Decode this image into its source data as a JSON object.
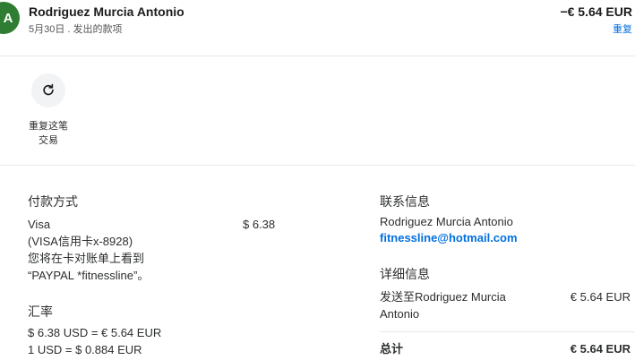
{
  "header": {
    "avatar_initial": "A",
    "name": "Rodriguez Murcia Antonio",
    "subtitle": "5月30日 . 发出的款项",
    "amount": "−€ 5.64 EUR",
    "link": "重复"
  },
  "actions": {
    "repeat_label_line1": "重复这笔",
    "repeat_label_line2": "交易"
  },
  "payment_method": {
    "title": "付款方式",
    "lines": [
      "Visa",
      "(VISA信用卡x-8928)",
      "您将在卡对账单上看到",
      "“PAYPAL *fitnessline”。"
    ],
    "amount": "$ 6.38"
  },
  "exchange": {
    "title": "汇率",
    "line1": "$ 6.38 USD = € 5.64 EUR",
    "line2": "1 USD = $ 0.884 EUR"
  },
  "contact": {
    "title": "联系信息",
    "name": "Rodriguez Murcia Antonio",
    "email": "fitnessline@hotmail.com"
  },
  "details": {
    "title": "详细信息",
    "sent_to_line1": "发送至Rodriguez Murcia",
    "sent_to_line2": "Antonio",
    "sent_amount": "€ 5.64 EUR",
    "total_label": "总计",
    "total_amount": "€ 5.64 EUR"
  },
  "colors": {
    "avatar": "#2e7d32",
    "link": "#0070e0"
  },
  "icons": {
    "repeat": "refresh-icon"
  }
}
